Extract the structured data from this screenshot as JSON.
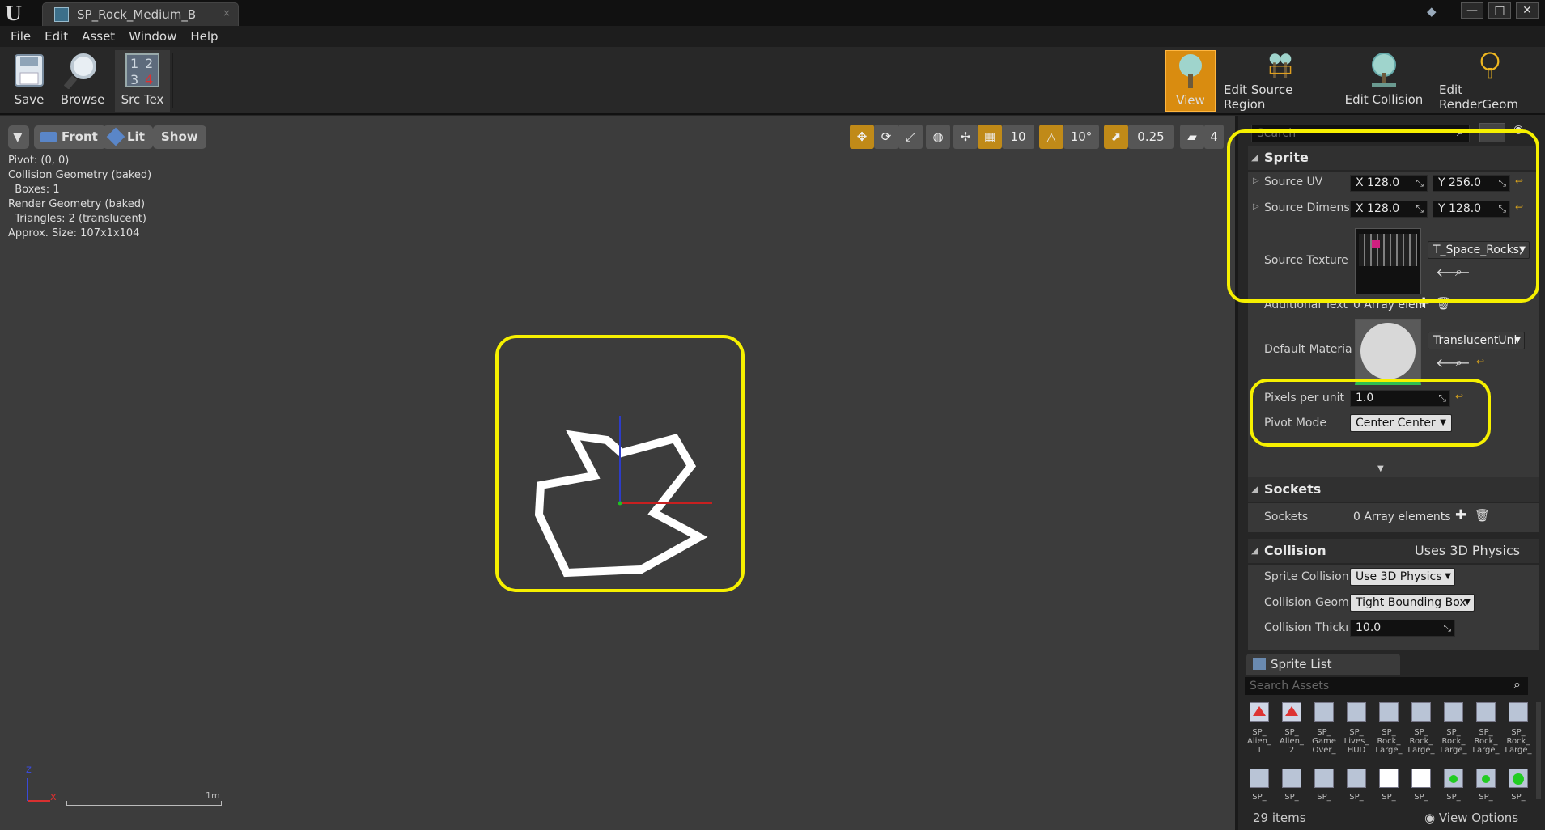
{
  "window": {
    "tab_title": "SP_Rock_Medium_B",
    "tab_close": "×",
    "controls": [
      "—",
      "□",
      "✕"
    ]
  },
  "menu": [
    "File",
    "Edit",
    "Asset",
    "Window",
    "Help"
  ],
  "toolbar": {
    "save": "Save",
    "browse": "Browse",
    "src_tex": "Src Tex",
    "src_tex_digits": [
      "1",
      "2",
      "3",
      "4"
    ],
    "view": "View",
    "edit_source_region": "Edit Source Region",
    "edit_collision": "Edit Collision",
    "edit_render_geom": "Edit RenderGeom"
  },
  "viewport": {
    "dropdown": "▼",
    "front": "Front",
    "lit": "Lit",
    "show": "Show",
    "grid_snap": "10",
    "rotation_snap": "10°",
    "scale_snap": "0.25",
    "camera_speed": "4",
    "stats": [
      "Pivot: (0, 0)",
      "Collision Geometry (baked)",
      "  Boxes: 1",
      "Render Geometry (baked)",
      "  Triangles: 2 (translucent)",
      "Approx. Size: 107x1x104"
    ],
    "axis_z": "z",
    "axis_x": "x",
    "scale_label": "1m"
  },
  "details": {
    "search_placeholder": "Search",
    "sprite_section": "Sprite",
    "source_uv_label": "Source UV",
    "source_uv_x": "X  128.0",
    "source_uv_y": "Y  256.0",
    "source_dim_label": "Source Dimens",
    "source_dim_x": "X  128.0",
    "source_dim_y": "Y  128.0",
    "source_texture_label": "Source Texture",
    "source_texture_value": "T_Space_Rocks,",
    "additional_text_label": "Additional Text",
    "additional_text_value": "0 Array elem",
    "default_material_label": "Default Materia",
    "default_material_value": "TranslucentUnl",
    "pixels_per_unit_label": "Pixels per unit",
    "pixels_per_unit_value": "1.0",
    "pivot_mode_label": "Pivot Mode",
    "pivot_mode_value": "Center Center",
    "sockets_section": "Sockets",
    "sockets_label": "Sockets",
    "sockets_value": "0 Array elements",
    "collision_section": "Collision",
    "collision_note": "Uses 3D Physics",
    "sprite_collision_label": "Sprite Collision",
    "sprite_collision_value": "Use 3D Physics",
    "collision_geom_label": "Collision Geom",
    "collision_geom_value": "Tight Bounding Box",
    "collision_thick_label": "Collision Thickı",
    "collision_thick_value": "10.0"
  },
  "sprite_list": {
    "tab": "Sprite List",
    "search_placeholder": "Search Assets",
    "items_row1": [
      "SP_ Alien_ 1",
      "SP_ Alien_ 2",
      "SP_ Game Over_",
      "SP_ Lives_ HUD",
      "SP_ Rock_ Large_",
      "SP_ Rock_ Large_",
      "SP_ Rock_ Large_",
      "SP_ Rock_ Large_",
      "SP_ Rock_ Large_"
    ],
    "items_row2": [
      "SP_",
      "SP_",
      "SP_",
      "SP_",
      "SP_",
      "SP_",
      "SP_",
      "SP_",
      "SP_"
    ],
    "count": "29 items",
    "view_options": "View Options"
  }
}
